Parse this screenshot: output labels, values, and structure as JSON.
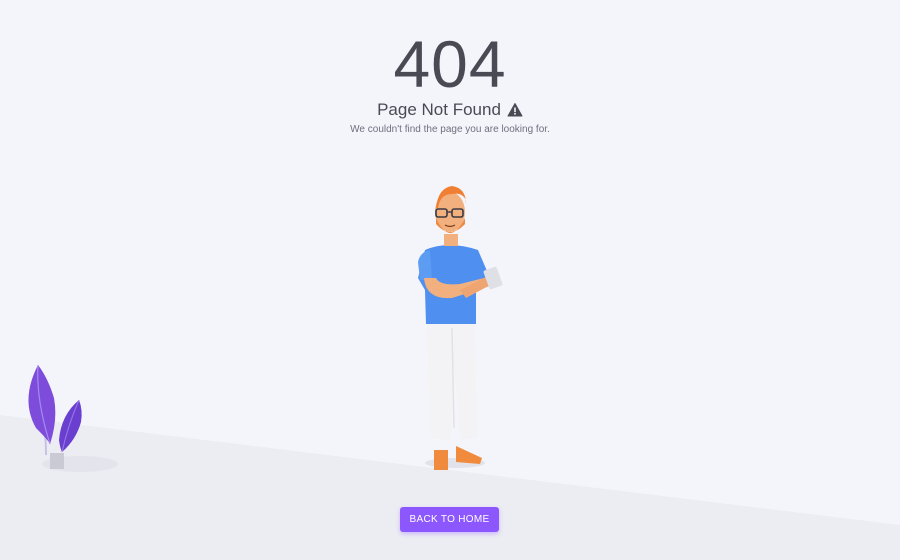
{
  "error": {
    "code": "404",
    "title": "Page Not Found",
    "title_icon": "warning-icon",
    "message": "We couldn't find the page you are looking for."
  },
  "actions": {
    "back_home_label": "BACK TO HOME"
  },
  "illustration": {
    "character": "man-holding-phone",
    "decoration": "purple-plant"
  },
  "colors": {
    "background": "#f4f5fa",
    "primary": "#8c57ff",
    "text": "#4a4a55",
    "muted": "#6f7080"
  }
}
